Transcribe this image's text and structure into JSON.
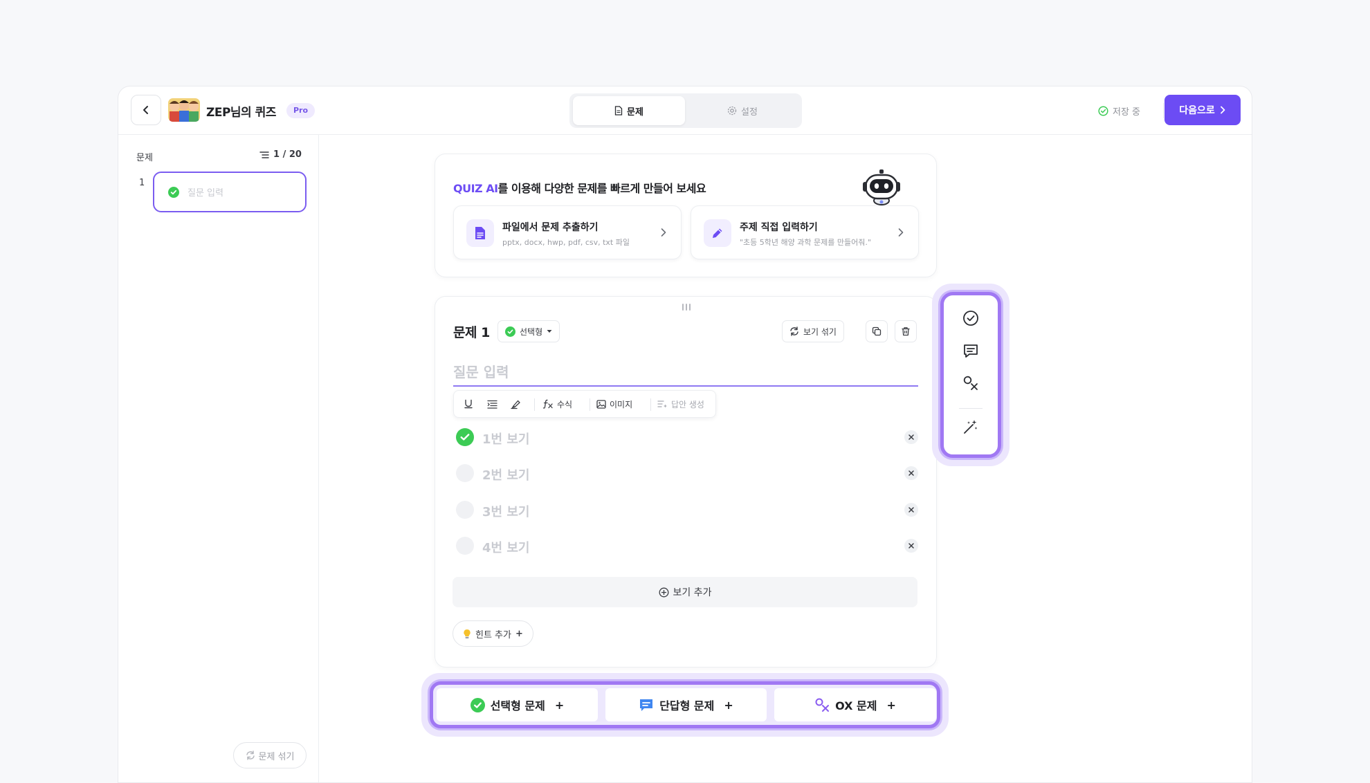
{
  "header": {
    "quiz_title": "ZEP님의 퀴즈",
    "pro_badge": "Pro",
    "tabs": [
      {
        "label": "문제",
        "active": true,
        "icon": "document-icon"
      },
      {
        "label": "설정",
        "active": false,
        "icon": "gear-icon"
      }
    ],
    "save_status": "저장 중",
    "next_button": "다음으로"
  },
  "sidebar": {
    "label": "문제",
    "count": "1 / 20",
    "items": [
      {
        "number": "1",
        "text": "질문 입력"
      }
    ],
    "shuffle_button": "문제 섞기"
  },
  "ai_card": {
    "title_accent": "QUIZ AI",
    "title_rest": "를 이용해 다양한 문제를 빠르게 만들어 보세요",
    "options": [
      {
        "title": "파일에서 문제 추출하기",
        "subtitle": "pptx, docx, hwp, pdf, csv, txt 파일",
        "icon": "file-icon"
      },
      {
        "title": "주제 직접 입력하기",
        "subtitle": "\"초등 5학년 해양 과학 문제를 만들어줘.\"",
        "icon": "pencil-icon"
      }
    ]
  },
  "question": {
    "title": "문제 1",
    "type_label": "선택형",
    "shuffle_label": "보기 섞기",
    "placeholder": "질문 입력",
    "toolbar": {
      "formula": "수식",
      "image": "이미지",
      "answer_gen": "답안 생성"
    },
    "choices": [
      {
        "label": "1번 보기",
        "correct": true
      },
      {
        "label": "2번 보기",
        "correct": false
      },
      {
        "label": "3번 보기",
        "correct": false
      },
      {
        "label": "4번 보기",
        "correct": false
      }
    ],
    "add_choice": "보기 추가",
    "hint_button": "힌트 추가"
  },
  "add_question": {
    "multiple_choice": "선택형 문제",
    "short_answer": "단답형 문제",
    "ox": "OX 문제"
  },
  "colors": {
    "accent": "#6c4cf4",
    "correct": "#3ccb55",
    "highlight_border": "#a078f3"
  }
}
